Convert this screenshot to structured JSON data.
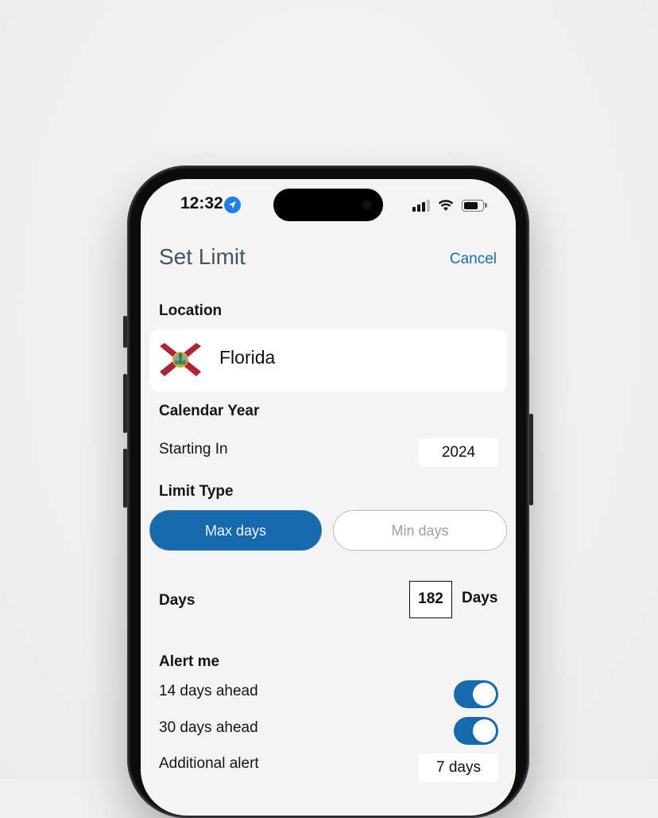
{
  "status_bar": {
    "time": "12:32"
  },
  "header": {
    "title": "Set Limit",
    "cancel_label": "Cancel"
  },
  "location": {
    "section_label": "Location",
    "name": "Florida",
    "flag_icon": "florida-flag-icon"
  },
  "calendar": {
    "section_label": "Calendar Year",
    "starting_label": "Starting In",
    "year": "2024"
  },
  "limit_type": {
    "section_label": "Limit Type",
    "options": [
      {
        "label": "Max days",
        "selected": true
      },
      {
        "label": "Min days",
        "selected": false
      }
    ]
  },
  "days": {
    "label": "Days",
    "value": "182",
    "unit": "Days"
  },
  "alerts": {
    "section_label": "Alert me",
    "items": [
      {
        "label": "14 days ahead",
        "enabled": true
      },
      {
        "label": "30 days ahead",
        "enabled": true
      }
    ],
    "additional_label": "Additional alert",
    "additional_value": "7 days"
  },
  "colors": {
    "accent": "#1769ad",
    "link": "#1a6ea8",
    "background": "#f4f4f4"
  }
}
